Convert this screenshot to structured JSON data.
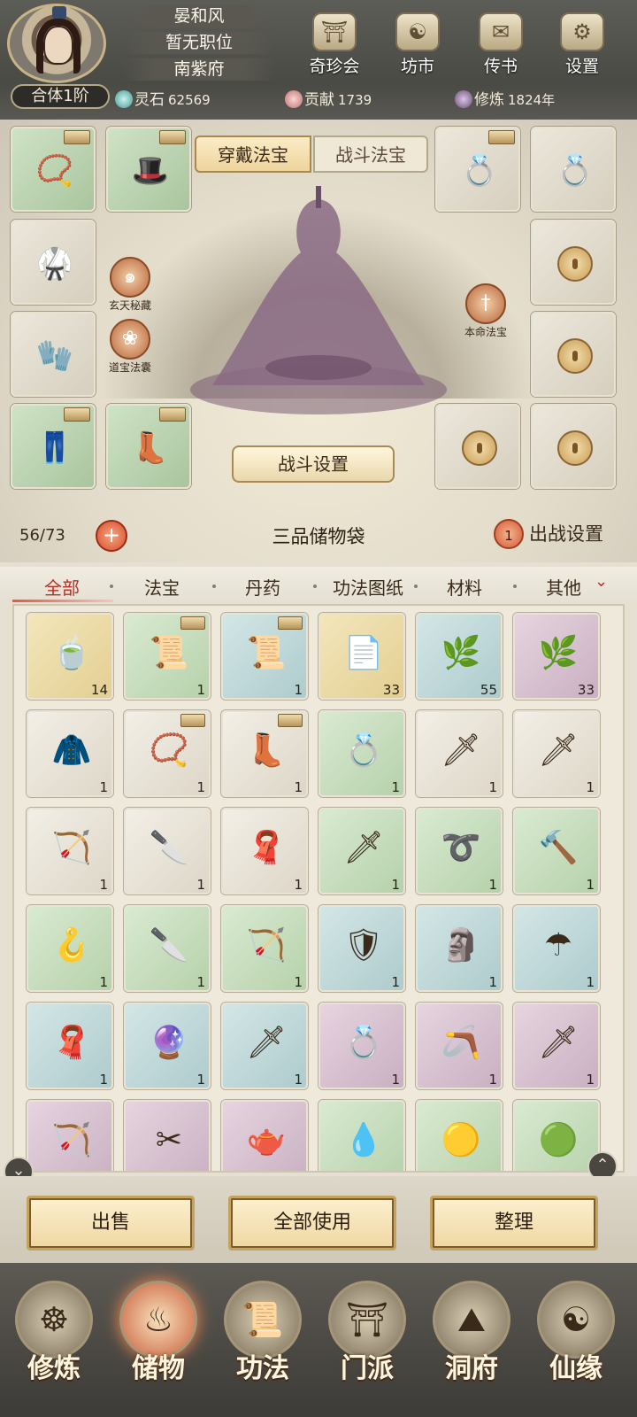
{
  "header": {
    "player_name": "晏和风",
    "position": "暂无职位",
    "location": "南紫府",
    "rank": "合体1阶",
    "top_icons": [
      {
        "label": "奇珍会",
        "icon": "treasure-pavilion-icon"
      },
      {
        "label": "坊市",
        "icon": "market-icon"
      },
      {
        "label": "传书",
        "icon": "scroll-letter-icon"
      },
      {
        "label": "设置",
        "icon": "gear-icon"
      }
    ],
    "resources": {
      "spirit_stone_label": "灵石",
      "spirit_stone_value": "62569",
      "contribution_label": "贡献",
      "contribution_value": "1739",
      "cultivation_label": "修炼",
      "cultivation_value": "1824年"
    }
  },
  "equipment": {
    "tabs": {
      "wear": "穿戴法宝",
      "battle": "战斗法宝"
    },
    "side_buttons": {
      "xuantian": "玄天秘藏",
      "daobao": "道宝法囊",
      "benming": "本命法宝"
    },
    "battle_settings": "战斗设置"
  },
  "storage": {
    "capacity": "56/73",
    "plus": "+",
    "bag_name": "三品储物袋",
    "deploy_count": "1",
    "deploy_label": "出战设置",
    "categories": [
      "全部",
      "法宝",
      "丹药",
      "功法图纸",
      "材料",
      "其他"
    ],
    "items": [
      {
        "c": "yellow",
        "i": "🍵",
        "n": "14"
      },
      {
        "c": "green",
        "i": "📜",
        "n": "1",
        "chest": true
      },
      {
        "c": "blue",
        "i": "📜",
        "n": "1",
        "chest": true
      },
      {
        "c": "yellow",
        "i": "📄",
        "n": "33"
      },
      {
        "c": "blue",
        "i": "🌿",
        "n": "55"
      },
      {
        "c": "purple",
        "i": "🌿",
        "n": "33"
      },
      {
        "c": "grey",
        "i": "🧥",
        "n": "1"
      },
      {
        "c": "grey",
        "i": "📿",
        "n": "1",
        "chest": true
      },
      {
        "c": "grey",
        "i": "👢",
        "n": "1",
        "chest": true
      },
      {
        "c": "green",
        "i": "💍",
        "n": "1"
      },
      {
        "c": "grey",
        "i": "🗡",
        "n": "1"
      },
      {
        "c": "grey",
        "i": "🗡",
        "n": "1"
      },
      {
        "c": "grey",
        "i": "🏹",
        "n": "1"
      },
      {
        "c": "grey",
        "i": "🔪",
        "n": "1"
      },
      {
        "c": "grey",
        "i": "🧣",
        "n": "1"
      },
      {
        "c": "green",
        "i": "🗡",
        "n": "1"
      },
      {
        "c": "green",
        "i": "➰",
        "n": "1"
      },
      {
        "c": "green",
        "i": "🔨",
        "n": "1"
      },
      {
        "c": "green",
        "i": "🪝",
        "n": "1"
      },
      {
        "c": "green",
        "i": "🔪",
        "n": "1"
      },
      {
        "c": "green",
        "i": "🏹",
        "n": "1"
      },
      {
        "c": "blue",
        "i": "🛡",
        "n": "1"
      },
      {
        "c": "blue",
        "i": "🗿",
        "n": "1"
      },
      {
        "c": "blue",
        "i": "☂",
        "n": "1"
      },
      {
        "c": "blue",
        "i": "🧣",
        "n": "1"
      },
      {
        "c": "blue",
        "i": "🔮",
        "n": "1"
      },
      {
        "c": "blue",
        "i": "🗡",
        "n": "1"
      },
      {
        "c": "purple",
        "i": "💍",
        "n": "1"
      },
      {
        "c": "purple",
        "i": "🪃",
        "n": "1"
      },
      {
        "c": "purple",
        "i": "🗡",
        "n": "1"
      },
      {
        "c": "purple",
        "i": "🏹",
        "n": ""
      },
      {
        "c": "purple",
        "i": "✂",
        "n": ""
      },
      {
        "c": "purple",
        "i": "🫖",
        "n": ""
      },
      {
        "c": "green",
        "i": "💧",
        "n": ""
      },
      {
        "c": "green",
        "i": "🟡",
        "n": ""
      },
      {
        "c": "green",
        "i": "🟢",
        "n": ""
      }
    ]
  },
  "actions": {
    "sell": "出售",
    "use_all": "全部使用",
    "organize": "整理"
  },
  "nav": [
    {
      "label": "修炼",
      "icon": "meditation-icon"
    },
    {
      "label": "储物",
      "icon": "storage-bag-icon",
      "active": true
    },
    {
      "label": "功法",
      "icon": "technique-scroll-icon"
    },
    {
      "label": "门派",
      "icon": "sect-gate-icon"
    },
    {
      "label": "洞府",
      "icon": "cave-mountain-icon"
    },
    {
      "label": "仙缘",
      "icon": "destiny-swirl-icon"
    }
  ],
  "colors": {
    "accent_red": "#b82f25",
    "frame_gold": "#c5a25e",
    "header_bg": "#4a4a45"
  }
}
